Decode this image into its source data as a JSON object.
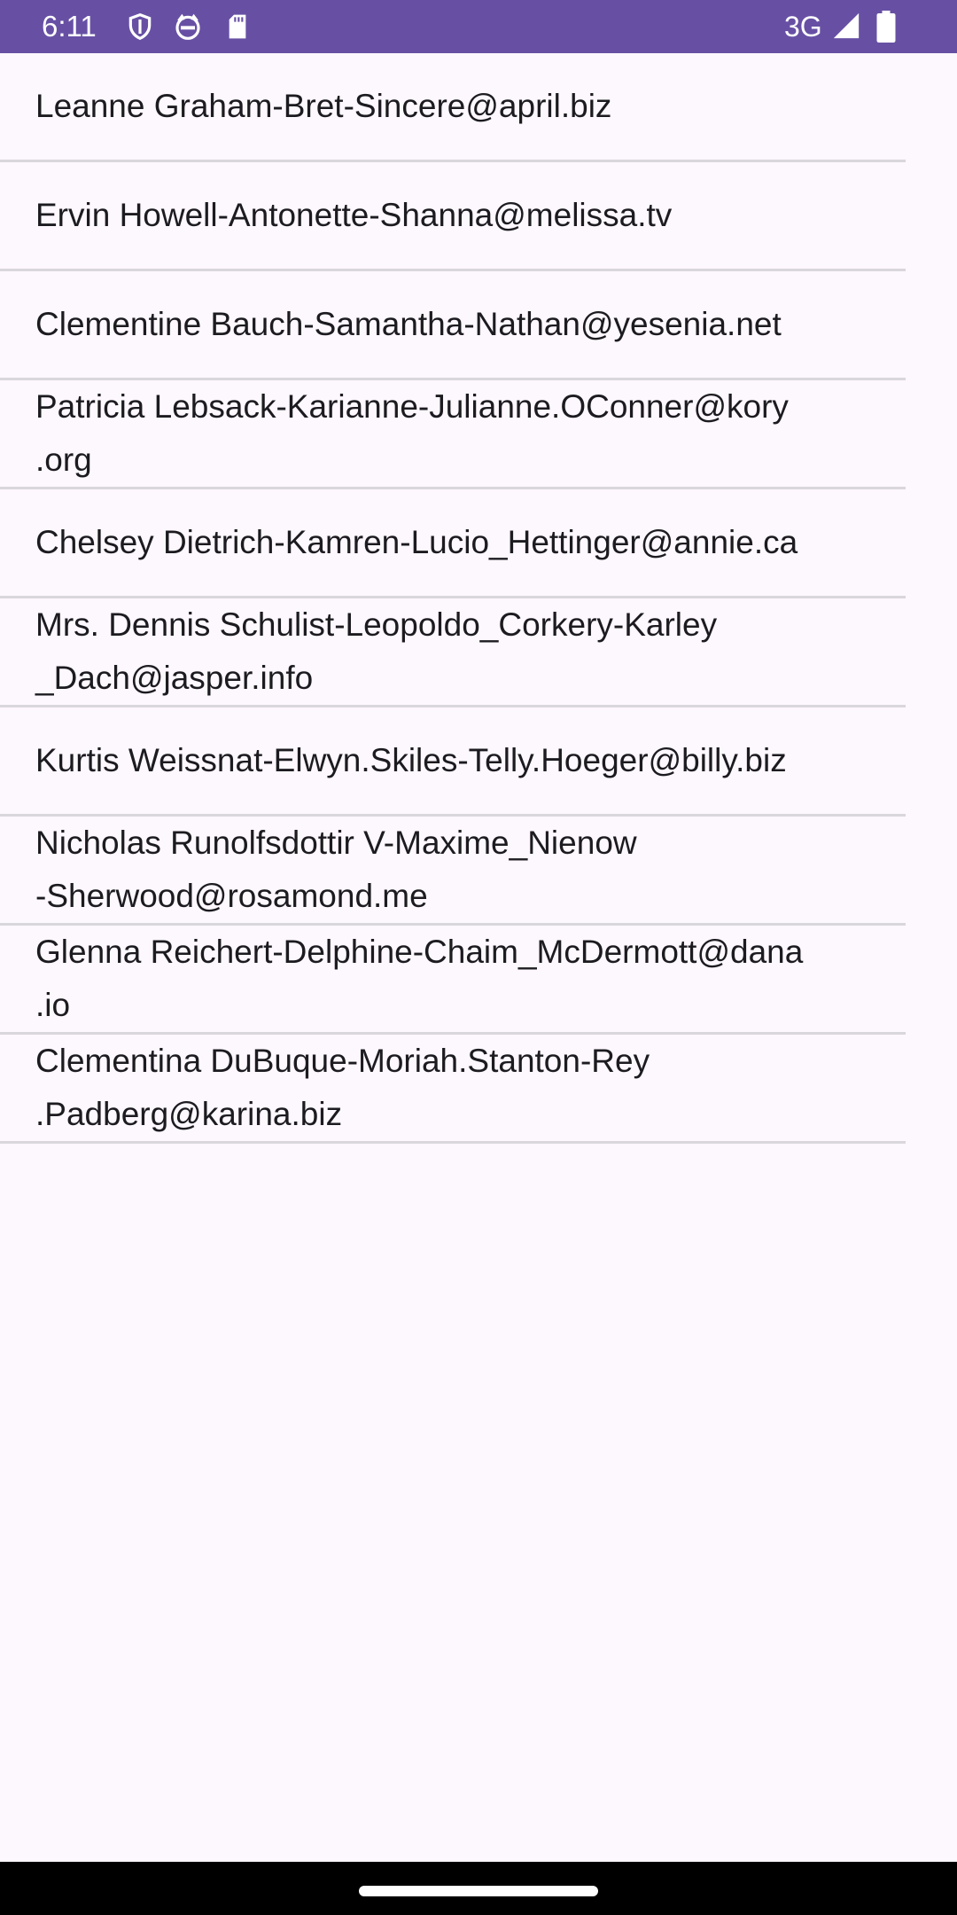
{
  "status_bar": {
    "time": "6:11",
    "network": "3G",
    "icons": [
      "shield-icon",
      "cat-icon",
      "sd-card-icon",
      "signal-icon",
      "battery-icon"
    ],
    "background": "#6750a4"
  },
  "users": [
    {
      "text": "Leanne Graham-Bret-Sincere@april.biz"
    },
    {
      "text": "Ervin Howell-Antonette-Shanna@melissa.tv"
    },
    {
      "text": "Clementine Bauch-Samantha-Nathan@yesenia.net"
    },
    {
      "text": "Patricia Lebsack-Karianne-Julianne.OConner@kory\n.org"
    },
    {
      "text": "Chelsey Dietrich-Kamren-Lucio_Hettinger@annie.ca"
    },
    {
      "text": "Mrs. Dennis Schulist-Leopoldo_Corkery-Karley\n_Dach@jasper.info"
    },
    {
      "text": "Kurtis Weissnat-Elwyn.Skiles-Telly.Hoeger@billy.biz"
    },
    {
      "text": "Nicholas Runolfsdottir V-Maxime_Nienow\n-Sherwood@rosamond.me"
    },
    {
      "text": "Glenna Reichert-Delphine-Chaim_McDermott@dana\n.io"
    },
    {
      "text": "Clementina DuBuque-Moriah.Stanton-Rey\n.Padberg@karina.biz"
    }
  ]
}
